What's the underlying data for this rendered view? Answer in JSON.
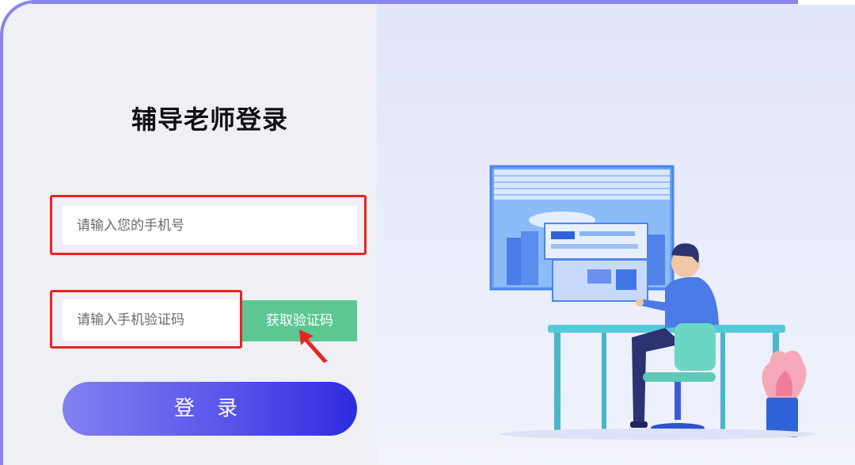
{
  "login": {
    "title": "辅导老师登录",
    "phone_placeholder": "请输入您的手机号",
    "code_placeholder": "请输入手机验证码",
    "get_code_label": "获取验证码",
    "submit_label": "登 录"
  },
  "colors": {
    "accent": "#8a84ee",
    "get_code_button": "#5dc794",
    "login_gradient_start": "#8280f0",
    "login_gradient_end": "#2e2be0",
    "annotation": "#e8241f"
  },
  "illustration": {
    "subject": "person-at-desk-computer-icon"
  }
}
